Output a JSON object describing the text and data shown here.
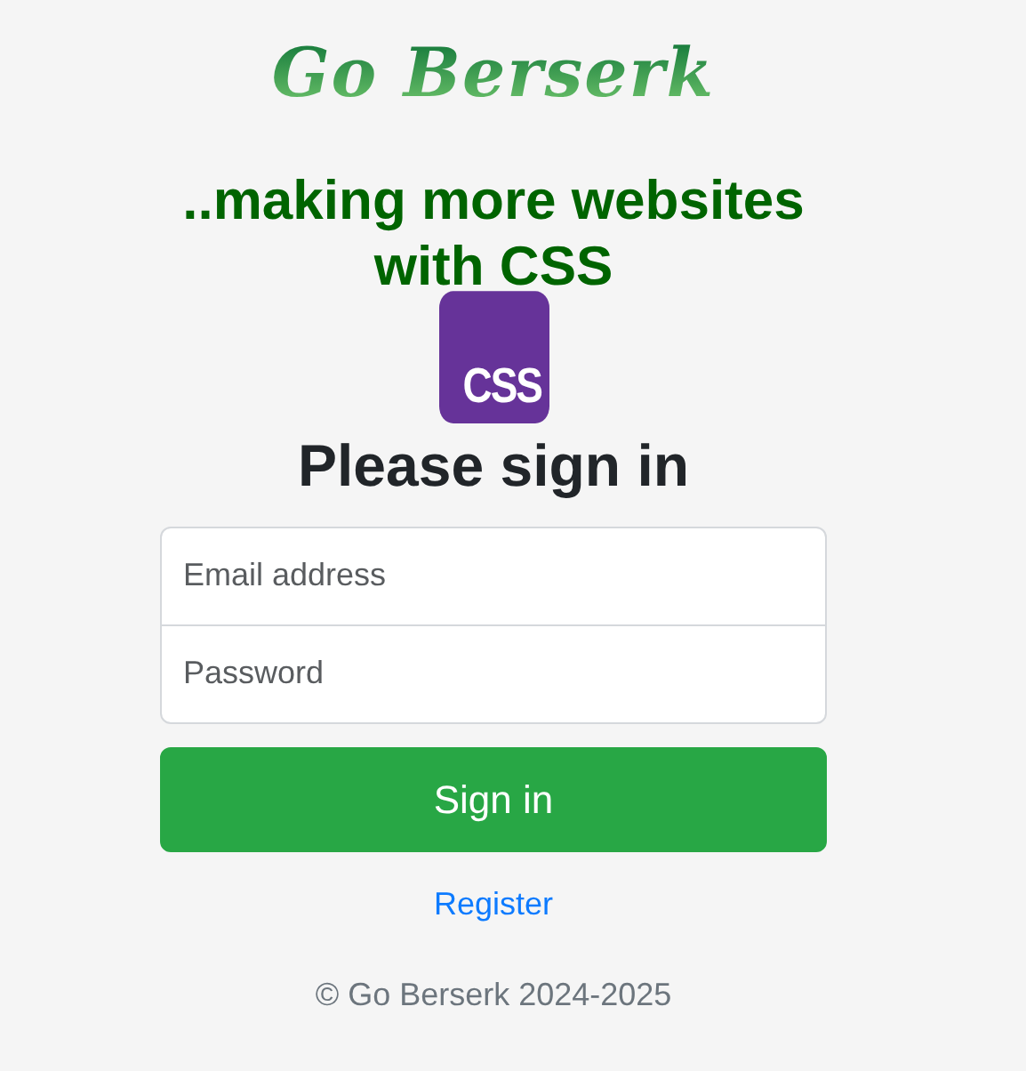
{
  "logo": {
    "text": "Go Berserk"
  },
  "tagline": "..making more websites with CSS",
  "badge": {
    "text": "CSS"
  },
  "heading": "Please sign in",
  "fields": [
    {
      "placeholder": "Email address"
    },
    {
      "placeholder": "Password"
    }
  ],
  "submit": "Sign in",
  "register_link": "Register",
  "footer": "© Go Berserk 2024-2025"
}
